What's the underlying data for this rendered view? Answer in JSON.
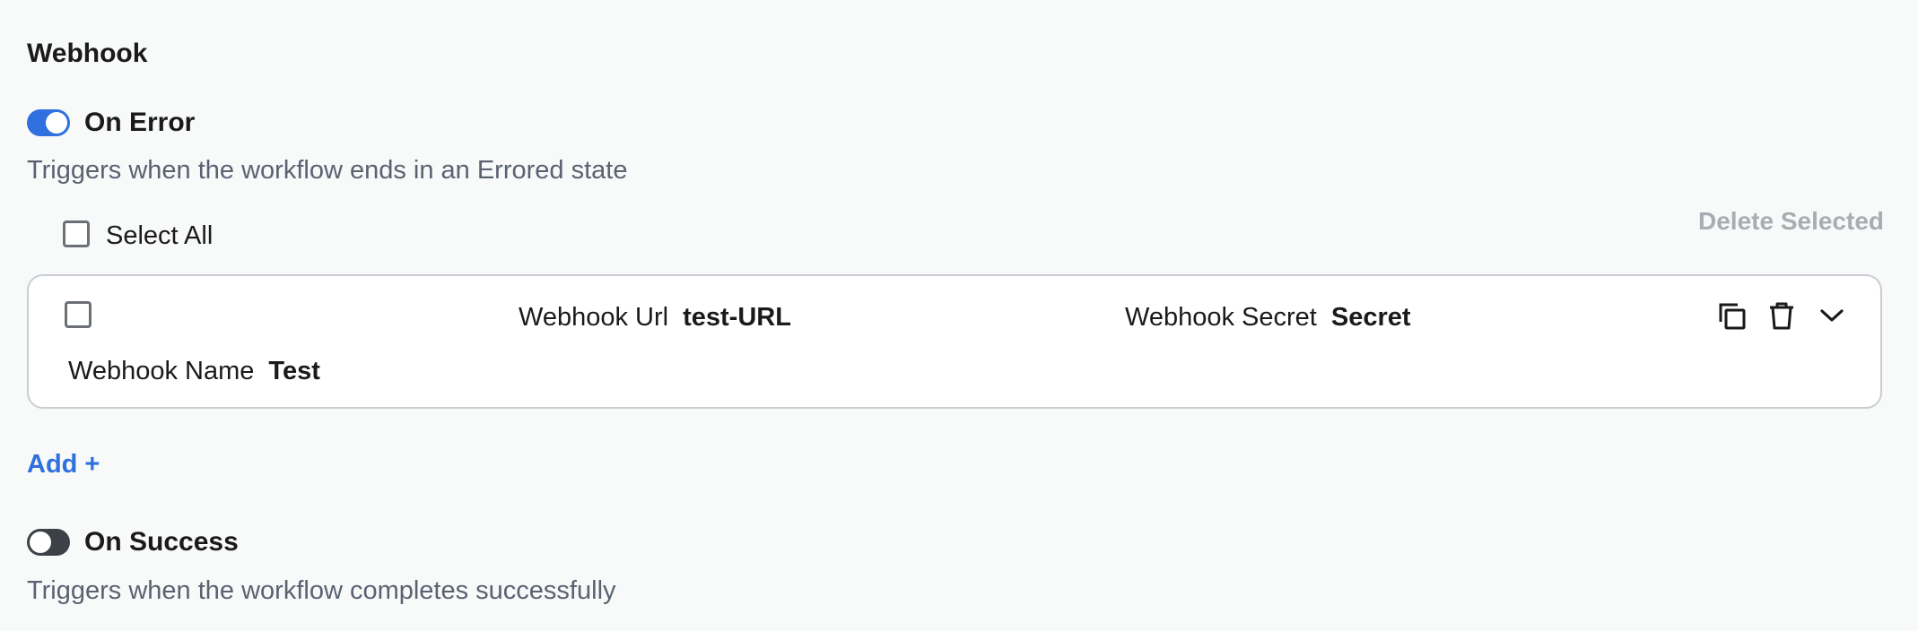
{
  "section": {
    "title": "Webhook"
  },
  "on_error": {
    "label": "On Error",
    "enabled": true,
    "description": "Triggers when the workflow ends in an Errored state"
  },
  "list": {
    "select_all_label": "Select All",
    "delete_selected_label": "Delete Selected",
    "rows": [
      {
        "url_label": "Webhook Url",
        "url_value": "test-URL",
        "secret_label": "Webhook Secret",
        "secret_value": "Secret",
        "name_label": "Webhook Name",
        "name_value": "Test"
      }
    ],
    "row_actions": [
      "copy-icon",
      "trash-icon",
      "chevron-down-icon"
    ]
  },
  "add": {
    "label": "Add +"
  },
  "on_success": {
    "label": "On Success",
    "enabled": false,
    "description": "Triggers when the workflow completes successfully"
  },
  "colors": {
    "accent": "#2f6fde",
    "toggle_off": "#3c4047",
    "muted_text": "#5a6272",
    "disabled_text": "#a9acb1"
  }
}
